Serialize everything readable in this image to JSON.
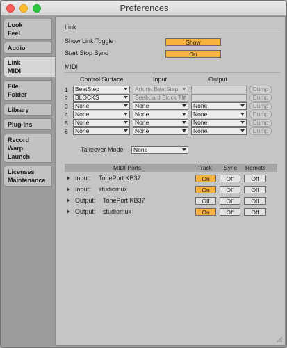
{
  "window": {
    "title": "Preferences"
  },
  "sidebar": {
    "tabs": [
      {
        "line1": "Look",
        "line2": "Feel"
      },
      {
        "line1": "Audio",
        "line2": ""
      },
      {
        "line1": "Link",
        "line2": "MIDI"
      },
      {
        "line1": "File",
        "line2": "Folder"
      },
      {
        "line1": "Library",
        "line2": ""
      },
      {
        "line1": "Plug-Ins",
        "line2": ""
      },
      {
        "line1": "Record",
        "line2": "Warp",
        "line3": "Launch"
      },
      {
        "line1": "Licenses",
        "line2": "Maintenance"
      }
    ]
  },
  "link": {
    "header": "Link",
    "show_toggle_label": "Show Link Toggle",
    "show_toggle_value": "Show",
    "start_stop_label": "Start Stop Sync",
    "start_stop_value": "On"
  },
  "midi": {
    "header": "MIDI",
    "col_control_surface": "Control Surface",
    "col_input": "Input",
    "col_output": "Output",
    "dump_label": "Dump",
    "rows": [
      {
        "num": "1",
        "surface": "BeatStep",
        "input": "Arturia BeatStep",
        "output": ""
      },
      {
        "num": "2",
        "surface": "BLOCKS",
        "input": "Seaboard Block TM",
        "output": ""
      },
      {
        "num": "3",
        "surface": "None",
        "input": "None",
        "output": "None"
      },
      {
        "num": "4",
        "surface": "None",
        "input": "None",
        "output": "None"
      },
      {
        "num": "5",
        "surface": "None",
        "input": "None",
        "output": "None"
      },
      {
        "num": "6",
        "surface": "None",
        "input": "None",
        "output": "None"
      }
    ],
    "takeover_label": "Takeover Mode",
    "takeover_value": "None"
  },
  "ports": {
    "col_ports": "MIDI Ports",
    "col_track": "Track",
    "col_sync": "Sync",
    "col_remote": "Remote",
    "rows": [
      {
        "dir": "Input:",
        "name": "TonePort KB37",
        "track": "On",
        "sync": "Off",
        "remote": "Off"
      },
      {
        "dir": "Input:",
        "name": "studiomux",
        "track": "On",
        "sync": "Off",
        "remote": "Off"
      },
      {
        "dir": "Output:",
        "name": "TonePort KB37",
        "track": "Off",
        "sync": "Off",
        "remote": "Off"
      },
      {
        "dir": "Output:",
        "name": "studiomux",
        "track": "On",
        "sync": "Off",
        "remote": "Off"
      }
    ]
  }
}
